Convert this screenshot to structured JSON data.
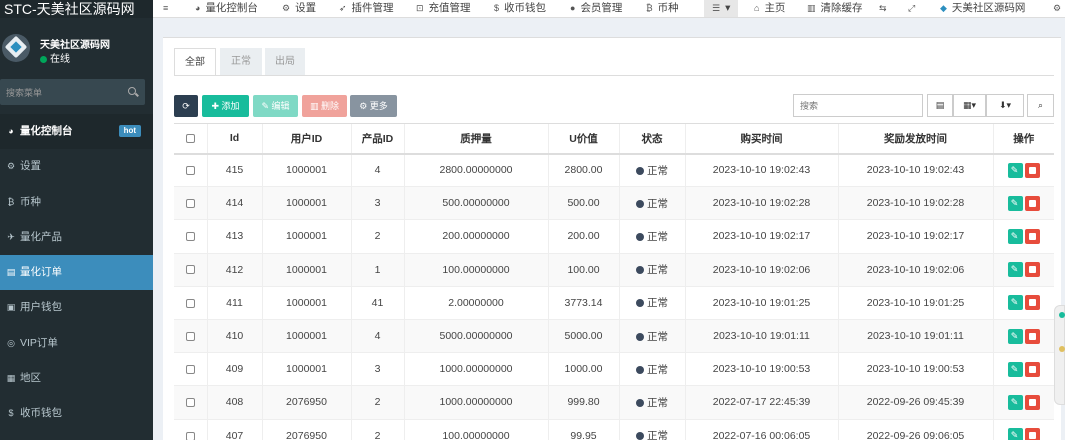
{
  "brand": {
    "title": "STC-天美社区源码网"
  },
  "user": {
    "name": "天美社区源码网",
    "status": "在线"
  },
  "sidebar": {
    "search_placeholder": "搜索菜单",
    "hot_badge": "hot",
    "items": [
      {
        "label": "量化控制台",
        "icon": "dashboard-icon"
      },
      {
        "label": "设置",
        "icon": "gear-icon"
      },
      {
        "label": "币种",
        "icon": "bitcoin-icon"
      },
      {
        "label": "量化产品",
        "icon": "plane-icon"
      },
      {
        "label": "量化订单",
        "icon": "file-icon"
      },
      {
        "label": "用户钱包",
        "icon": "wallet-icon"
      },
      {
        "label": "VIP订单",
        "icon": "vip-icon"
      },
      {
        "label": "地区",
        "icon": "map-icon"
      },
      {
        "label": "收币钱包",
        "icon": "dollar-icon"
      }
    ]
  },
  "topbar": {
    "items": [
      {
        "label": "量化控制台",
        "icon": "dashboard-icon"
      },
      {
        "label": "设置",
        "icon": "gear-icon"
      },
      {
        "label": "插件管理",
        "icon": "rocket-icon"
      },
      {
        "label": "充值管理",
        "icon": "recharge-icon"
      },
      {
        "label": "收币钱包",
        "icon": "dollar-icon"
      },
      {
        "label": "会员管理",
        "icon": "user-icon"
      },
      {
        "label": "币种",
        "icon": "bitcoin-icon"
      }
    ],
    "home_label": "主页",
    "clear_cache_label": "清除缓存",
    "site_label": "天美社区源码网"
  },
  "tabs": [
    "全部",
    "正常",
    "出局"
  ],
  "toolbar": {
    "add_label": "添加",
    "edit_label": "编辑",
    "delete_label": "删除",
    "more_label": "更多",
    "search_placeholder": "搜索"
  },
  "table": {
    "columns": [
      "Id",
      "用户ID",
      "产品ID",
      "质押量",
      "U价值",
      "状态",
      "购买时间",
      "奖励发放时间",
      "操作"
    ],
    "rows": [
      {
        "id": "415",
        "user_id": "1000001",
        "product_id": "4",
        "amount": "2800.00000000",
        "u_value": "2800.00",
        "status": "正常",
        "buy_time": "2023-10-10 19:02:43",
        "reward_time": "2023-10-10 19:02:43"
      },
      {
        "id": "414",
        "user_id": "1000001",
        "product_id": "3",
        "amount": "500.00000000",
        "u_value": "500.00",
        "status": "正常",
        "buy_time": "2023-10-10 19:02:28",
        "reward_time": "2023-10-10 19:02:28"
      },
      {
        "id": "413",
        "user_id": "1000001",
        "product_id": "2",
        "amount": "200.00000000",
        "u_value": "200.00",
        "status": "正常",
        "buy_time": "2023-10-10 19:02:17",
        "reward_time": "2023-10-10 19:02:17"
      },
      {
        "id": "412",
        "user_id": "1000001",
        "product_id": "1",
        "amount": "100.00000000",
        "u_value": "100.00",
        "status": "正常",
        "buy_time": "2023-10-10 19:02:06",
        "reward_time": "2023-10-10 19:02:06"
      },
      {
        "id": "411",
        "user_id": "1000001",
        "product_id": "41",
        "amount": "2.00000000",
        "u_value": "3773.14",
        "status": "正常",
        "buy_time": "2023-10-10 19:01:25",
        "reward_time": "2023-10-10 19:01:25"
      },
      {
        "id": "410",
        "user_id": "1000001",
        "product_id": "4",
        "amount": "5000.00000000",
        "u_value": "5000.00",
        "status": "正常",
        "buy_time": "2023-10-10 19:01:11",
        "reward_time": "2023-10-10 19:01:11"
      },
      {
        "id": "409",
        "user_id": "1000001",
        "product_id": "3",
        "amount": "1000.00000000",
        "u_value": "1000.00",
        "status": "正常",
        "buy_time": "2023-10-10 19:00:53",
        "reward_time": "2023-10-10 19:00:53"
      },
      {
        "id": "408",
        "user_id": "2076950",
        "product_id": "2",
        "amount": "1000.00000000",
        "u_value": "999.80",
        "status": "正常",
        "buy_time": "2022-07-17 22:45:39",
        "reward_time": "2022-09-26 09:45:39"
      },
      {
        "id": "407",
        "user_id": "2076950",
        "product_id": "2",
        "amount": "100.00000000",
        "u_value": "99.95",
        "status": "正常",
        "buy_time": "2022-07-16 00:06:05",
        "reward_time": "2022-09-26 09:06:05"
      }
    ]
  },
  "colors": {
    "primary": "#3c8dbc",
    "success": "#18bc9c",
    "danger": "#e74c3c",
    "sidebar": "#222d32"
  }
}
